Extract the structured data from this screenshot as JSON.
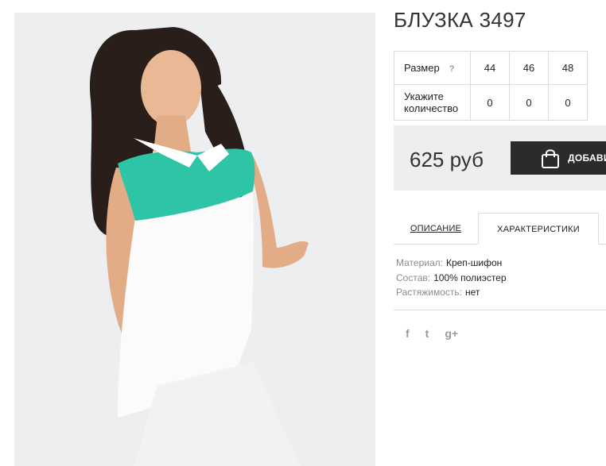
{
  "product": {
    "title": "БЛУЗКА 3497"
  },
  "size_table": {
    "size_label": "Размер",
    "help": "?",
    "sizes": [
      "44",
      "46",
      "48"
    ],
    "qty_label": "Укажите количество",
    "quantities": [
      "0",
      "0",
      "0"
    ]
  },
  "purchase": {
    "price": "625 руб",
    "add_label": "ДОБАВИТЬ"
  },
  "tabs": {
    "description": "ОПИСАНИЕ",
    "specs": "ХАРАКТЕРИСТИКИ"
  },
  "specs": [
    {
      "label": "Материал:",
      "value": "Креп-шифон"
    },
    {
      "label": "Состав:",
      "value": "100% полиэстер"
    },
    {
      "label": "Растяжимость:",
      "value": "нет"
    }
  ],
  "social": {
    "facebook": "f",
    "twitter": "t",
    "google": "g+"
  },
  "colors": {
    "accent": "#2ec4a6",
    "button": "#2b2b2b",
    "price_bg": "#eeeeee"
  },
  "icons": [
    "shopping-bag-icon",
    "facebook-icon",
    "twitter-icon",
    "google-plus-icon"
  ]
}
